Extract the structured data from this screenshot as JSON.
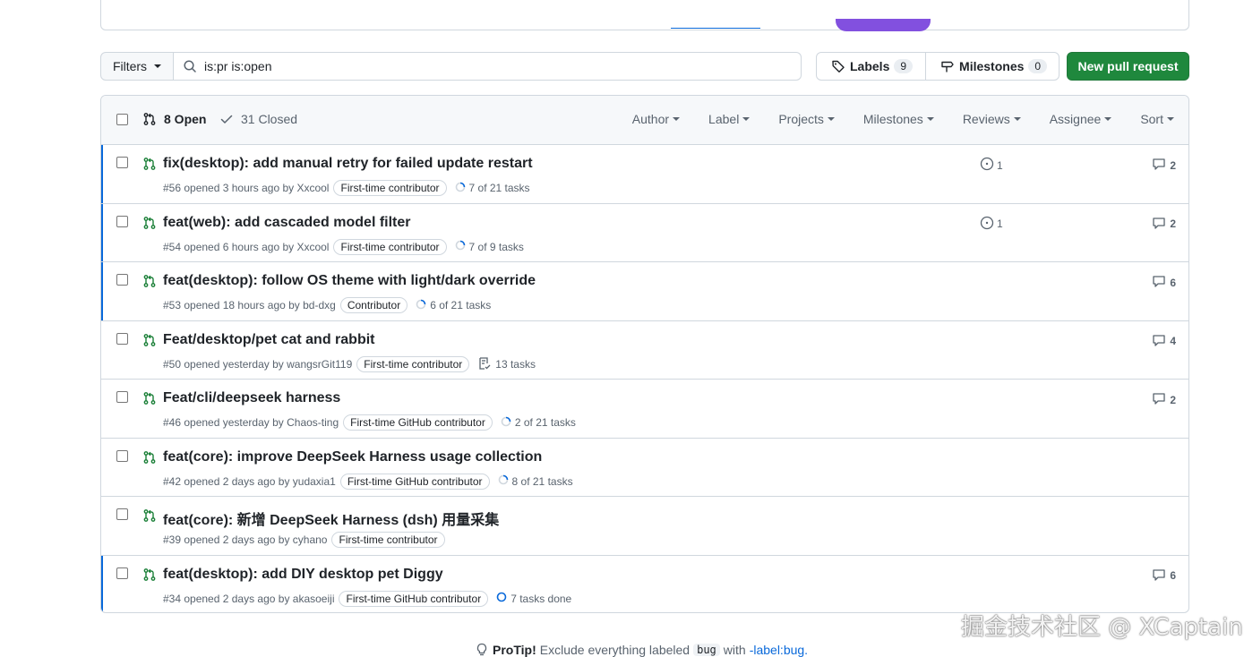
{
  "filter_bar": {
    "filters_label": "Filters",
    "search_value": "is:pr is:open",
    "labels_label": "Labels",
    "labels_count": "9",
    "milestones_label": "Milestones",
    "milestones_count": "0",
    "new_pr_label": "New pull request"
  },
  "list_header": {
    "open_label": "8 Open",
    "closed_label": "31 Closed",
    "filters": [
      "Author",
      "Label",
      "Projects",
      "Milestones",
      "Reviews",
      "Assignee",
      "Sort"
    ]
  },
  "pull_requests": [
    {
      "title": "fix(desktop): add manual retry for failed update restart",
      "meta": "#56 opened 3 hours ago by Xxcool",
      "label": "First-time contributor",
      "tasks": "7 of 21 tasks",
      "issues": "1",
      "comments": "2"
    },
    {
      "title": "feat(web): add cascaded model filter",
      "meta": "#54 opened 6 hours ago by Xxcool",
      "label": "First-time contributor",
      "tasks": "7 of 9 tasks",
      "issues": "1",
      "comments": "2"
    },
    {
      "title": "feat(desktop): follow OS theme with light/dark override",
      "meta": "#53 opened 18 hours ago by bd-dxg",
      "label": "Contributor",
      "tasks": "6 of 21 tasks",
      "issues": "",
      "comments": "6"
    },
    {
      "title": "Feat/desktop/pet cat and rabbit",
      "meta": "#50 opened yesterday by wangsrGit119",
      "label": "First-time contributor",
      "tasks": "13 tasks",
      "issues": "",
      "comments": "4"
    },
    {
      "title": "Feat/cli/deepseek harness",
      "meta": "#46 opened yesterday by Chaos-ting",
      "label": "First-time GitHub contributor",
      "tasks": "2 of 21 tasks",
      "issues": "",
      "comments": "2"
    },
    {
      "title": "feat(core): improve DeepSeek Harness usage collection",
      "meta": "#42 opened 2 days ago by yudaxia1",
      "label": "First-time GitHub contributor",
      "tasks": "8 of 21 tasks",
      "issues": "",
      "comments": ""
    },
    {
      "title": "feat(core): 新增 DeepSeek Harness (dsh) 用量采集",
      "meta": "#39 opened 2 days ago by cyhano",
      "label": "First-time contributor",
      "tasks": "",
      "issues": "",
      "comments": ""
    },
    {
      "title": "feat(desktop): add DIY desktop pet Diggy",
      "meta": "#34 opened 2 days ago by akasoeiji",
      "label": "First-time GitHub contributor",
      "tasks": "7 tasks done",
      "issues": "",
      "comments": "6"
    }
  ],
  "protip": {
    "lead": "ProTip!",
    "text_1": "Exclude everything labeled",
    "code": "bug",
    "text_2": "with",
    "link": "-label:bug."
  },
  "watermark": "掘金技术社区 @ XCaptain",
  "colors": {
    "accent": "#0969da",
    "open_green": "#1a7f37",
    "primary_button": "#1f883d",
    "border": "#d0d7de"
  }
}
